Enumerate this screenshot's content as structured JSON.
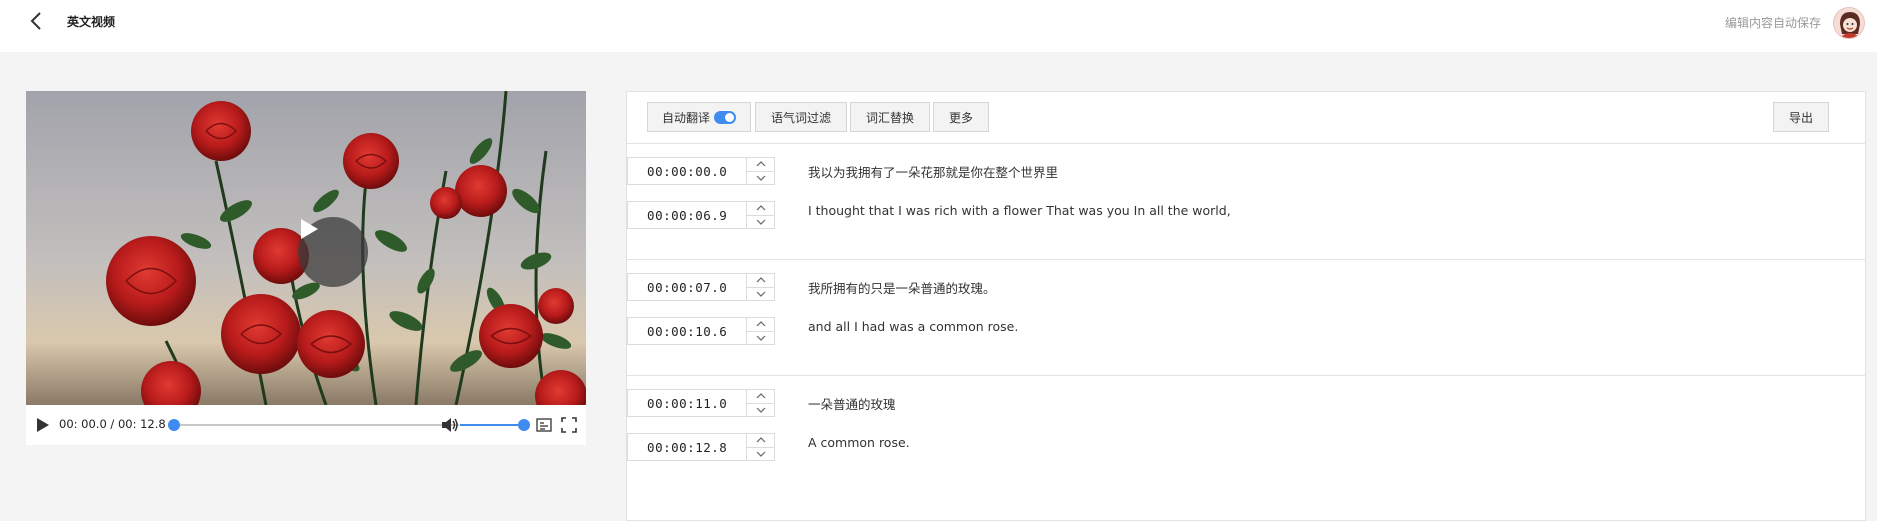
{
  "header": {
    "title": "英文视频",
    "autosave_text": "编辑内容自动保存"
  },
  "player": {
    "time": "00: 00.0 / 00: 12.8",
    "progress_fraction": 0.0,
    "volume_fraction": 1.0
  },
  "toolbar": {
    "auto_translate": "自动翻译",
    "auto_translate_on": true,
    "filler_filter": "语气词过滤",
    "word_replace": "词汇替换",
    "more": "更多",
    "export": "导出"
  },
  "segments": [
    {
      "start": "00:00:00.0",
      "end": "00:00:06.9",
      "source": "我以为我拥有了一朵花那就是你在整个世界里",
      "translation": "I thought that I was rich with a flower That was you In all the world,"
    },
    {
      "start": "00:00:07.0",
      "end": "00:00:10.6",
      "source": "我所拥有的只是一朵普通的玫瑰。",
      "translation": "and all I had was a common rose."
    },
    {
      "start": "00:00:11.0",
      "end": "00:00:12.8",
      "source": "一朵普通的玫瑰",
      "translation": "A common rose."
    }
  ],
  "colors": {
    "accent": "#3f8cf0",
    "rose": "#c21f1f",
    "leaf": "#2f5b2a"
  },
  "icons": {
    "back": "chevron-left-icon",
    "play": "play-icon",
    "volume": "volume-icon",
    "subtitles": "subtitles-icon",
    "fullscreen": "fullscreen-icon",
    "stepper_up": "chevron-up-icon",
    "stepper_down": "chevron-down-icon"
  }
}
